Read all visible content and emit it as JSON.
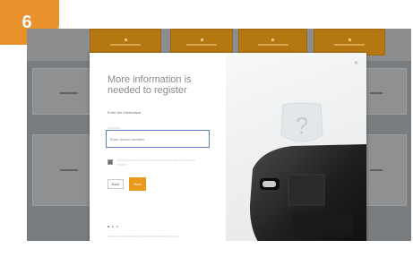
{
  "step": {
    "number": "6"
  },
  "modal": {
    "title": "More information is needed to register",
    "subtitle": "Enter the information",
    "field": {
      "value": "Enter device identifier"
    },
    "back_label": "Back",
    "next_label": "Next"
  },
  "colors": {
    "accent": "#e89a1a",
    "step_badge": "#e8902a",
    "field_border": "#5b7fc6",
    "backdrop": "#7a7d7f"
  },
  "icons": {
    "close": "close-icon",
    "question": "question-icon",
    "device": "device-photo"
  }
}
